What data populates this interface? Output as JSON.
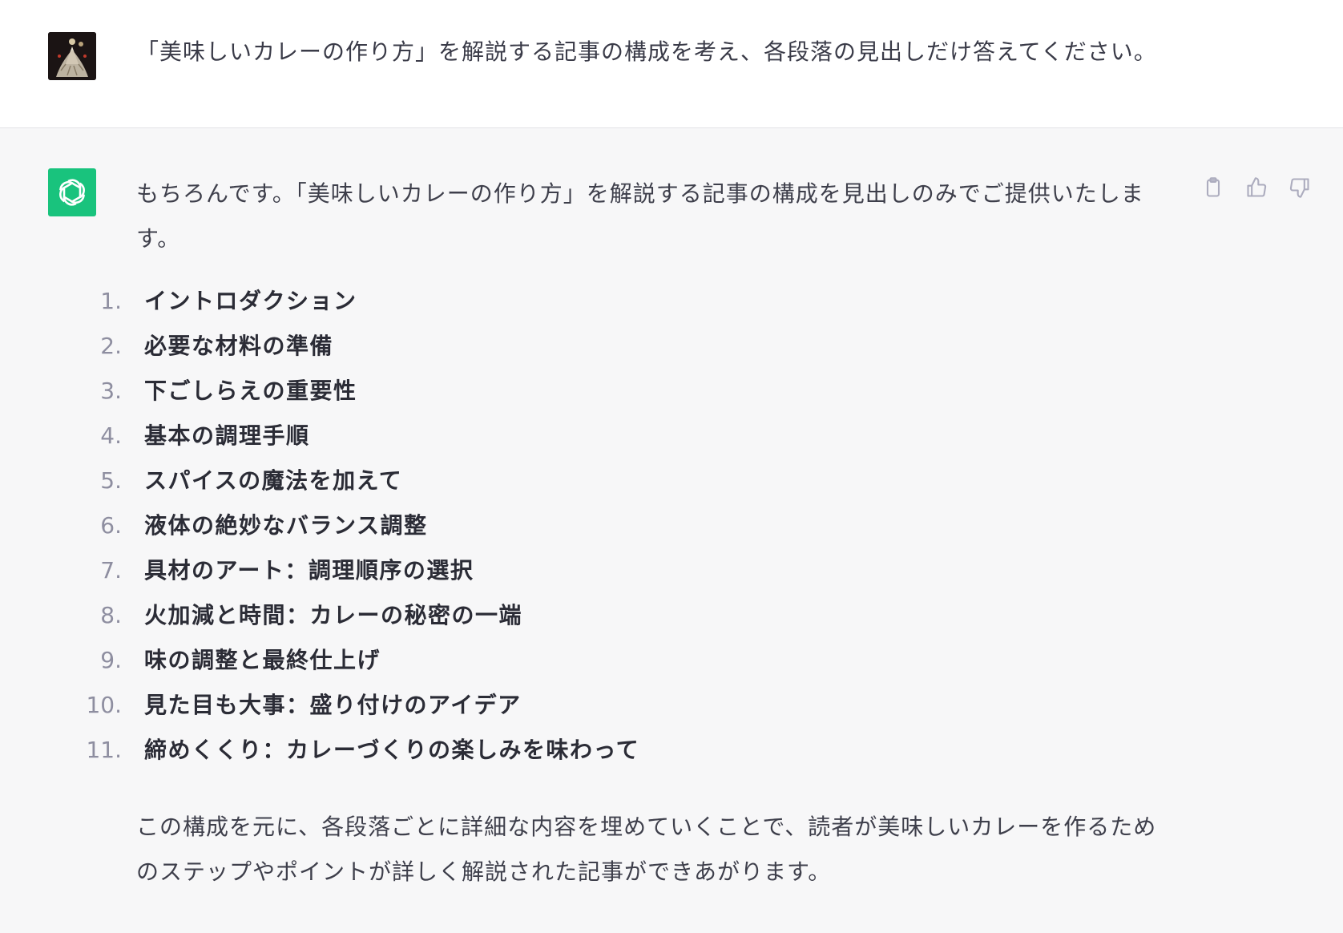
{
  "user_message": {
    "text": "「美味しいカレーの作り方」を解説する記事の構成を考え、各段落の見出しだけ答えてください。",
    "avatar_icon": "user-avatar-image"
  },
  "assistant_message": {
    "avatar_icon": "openai-logo-icon",
    "intro": "もちろんです。「美味しいカレーの作り方」を解説する記事の構成を見出しのみでご提供いたします。",
    "steps": [
      {
        "num": "1.",
        "text": "イントロダクション"
      },
      {
        "num": "2.",
        "text": "必要な材料の準備"
      },
      {
        "num": "3.",
        "text": "下ごしらえの重要性"
      },
      {
        "num": "4.",
        "text": "基本の調理手順"
      },
      {
        "num": "5.",
        "text": "スパイスの魔法を加えて"
      },
      {
        "num": "6.",
        "text": "液体の絶妙なバランス調整"
      },
      {
        "num": "7.",
        "text": "具材のアート：調理順序の選択"
      },
      {
        "num": "8.",
        "text": "火加減と時間：カレーの秘密の一端"
      },
      {
        "num": "9.",
        "text": "味の調整と最終仕上げ"
      },
      {
        "num": "10.",
        "text": "見た目も大事：盛り付けのアイデア"
      },
      {
        "num": "11.",
        "text": "締めくくり：カレーづくりの楽しみを味わって"
      }
    ],
    "outro": "この構成を元に、各段落ごとに詳細な内容を埋めていくことで、読者が美味しいカレーを作るためのステップやポイントが詳しく解説された記事ができあがります。",
    "actions": [
      "clipboard-icon",
      "thumbs-up-icon",
      "thumbs-down-icon"
    ]
  },
  "colors": {
    "gpt_green": "#19c37d",
    "assistant_bg": "#f7f7f8",
    "user_bg": "#ffffff",
    "text": "#343541",
    "muted": "#8e8ea0"
  }
}
